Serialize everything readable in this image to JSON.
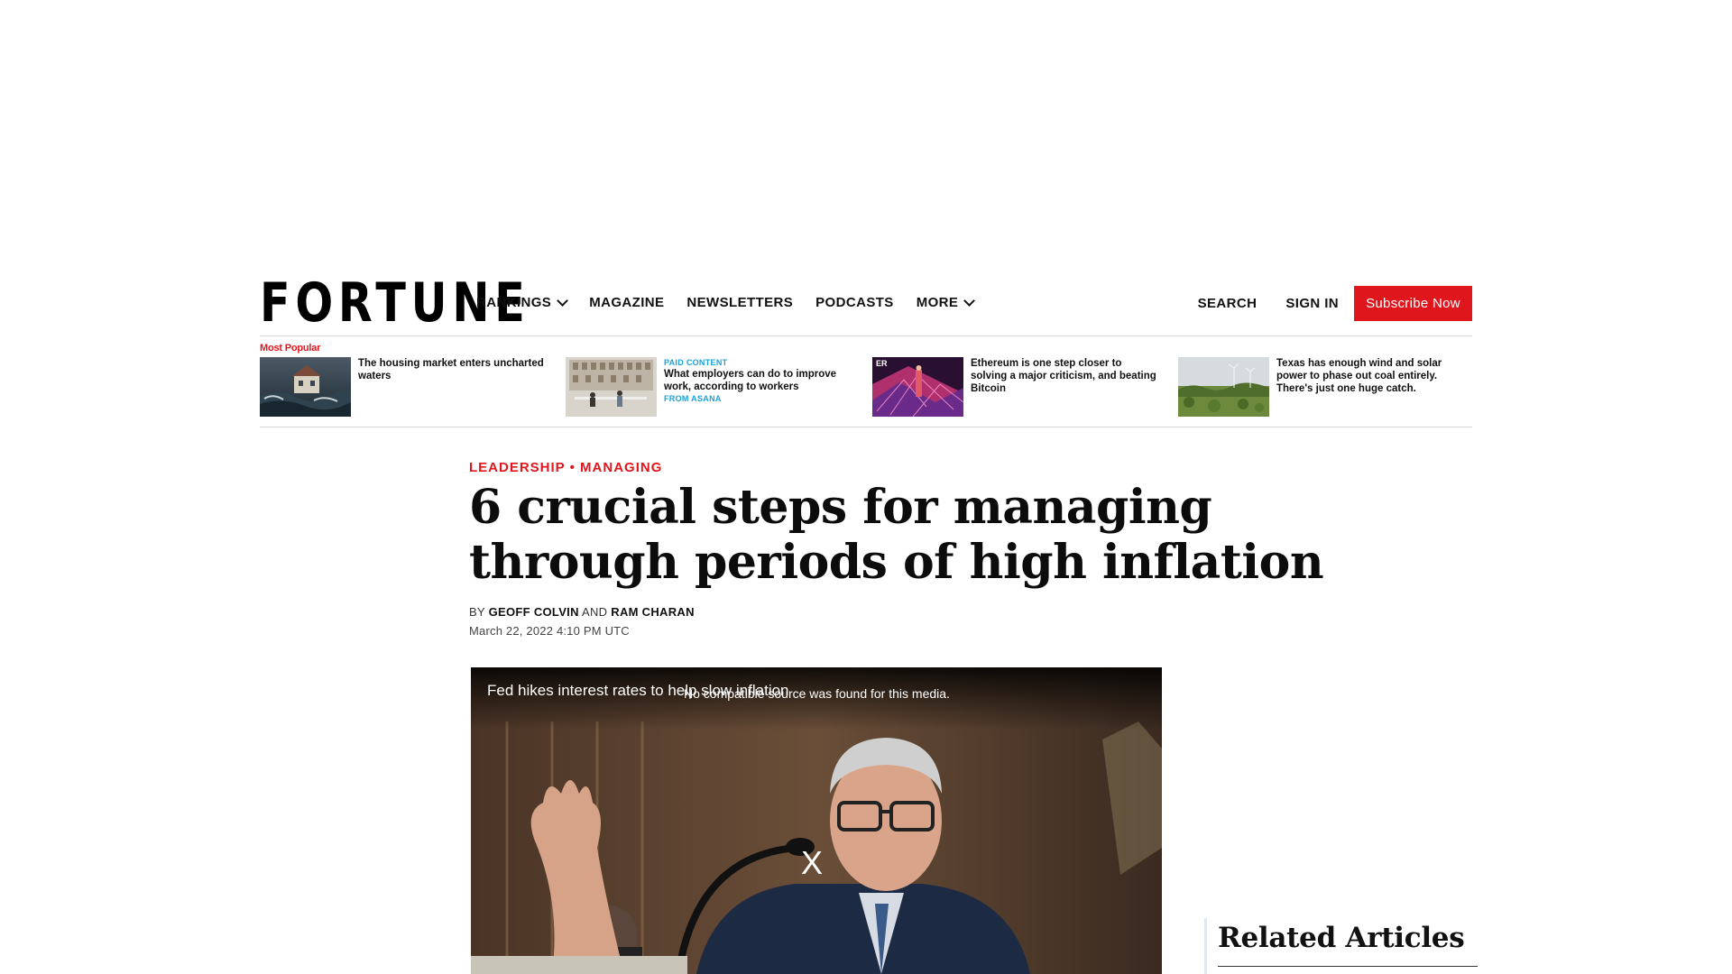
{
  "header": {
    "logo": "FORTUNE",
    "nav": [
      {
        "label": "RANKINGS",
        "has_dropdown": true
      },
      {
        "label": "MAGAZINE",
        "has_dropdown": false
      },
      {
        "label": "NEWSLETTERS",
        "has_dropdown": false
      },
      {
        "label": "PODCASTS",
        "has_dropdown": false
      },
      {
        "label": "MORE",
        "has_dropdown": true
      }
    ],
    "search_label": "SEARCH",
    "signin_label": "SIGN IN",
    "subscribe_label": "Subscribe Now"
  },
  "most_popular": {
    "label": "Most Popular",
    "items": [
      {
        "headline": "The housing market enters uncharted waters",
        "tag_top": "",
        "tag_bottom": ""
      },
      {
        "headline": "What employers can do to improve work, according to workers",
        "tag_top": "PAID CONTENT",
        "tag_bottom": "FROM ASANA"
      },
      {
        "headline": "Ethereum is one step closer to solving a major criticism, and beating Bitcoin",
        "tag_top": "",
        "tag_bottom": ""
      },
      {
        "headline": "Texas has enough wind and solar power to phase out coal entirely. There's just one huge catch.",
        "tag_top": "",
        "tag_bottom": ""
      }
    ]
  },
  "article": {
    "section": "LEADERSHIP",
    "separator": "•",
    "subsection": "MANAGING",
    "title": "6 crucial steps for managing through periods of high inflation",
    "by": "BY",
    "author1": "GEOFF COLVIN",
    "and": "AND",
    "author2": "RAM CHARAN",
    "date": "March 22, 2022 4:10 PM UTC"
  },
  "video": {
    "title": "Fed hikes interest rates to help slow inflation",
    "error": "No compatible source was found for this media.",
    "close": "X"
  },
  "related": {
    "title": "Related Articles"
  },
  "colors": {
    "accent": "#e0161d",
    "paid_tag": "#1aa3d8"
  }
}
